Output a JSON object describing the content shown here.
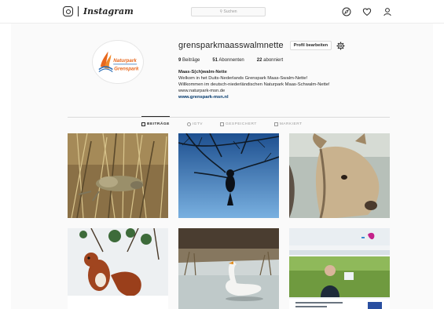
{
  "app": {
    "logo_text": "Instagram"
  },
  "search": {
    "placeholder": "Suchen"
  },
  "nav": {
    "icons": [
      "compass-icon",
      "heart-icon",
      "person-icon"
    ]
  },
  "profile": {
    "username": "grensparkmaasswalmnette",
    "edit_label": "Profil bearbeiten",
    "stats": [
      {
        "count": "9",
        "label": "Beiträge"
      },
      {
        "count": "51",
        "label": "Abonnenten"
      },
      {
        "count": "22",
        "label": "abonniert"
      }
    ],
    "bio": {
      "name": "Maas-S(ch)walm-Nette",
      "line1": "Welkom in het Duits-Nederlands Grenspark Maas-Swalm-Nette!",
      "line2": "Willkommen im deutsch-niederländischen Naturpark Maas-Schwalm-Nette!",
      "line3": "www.naturpark-msn.de",
      "link": "www.grenspark-msn.nl"
    },
    "avatar_text": {
      "top": "Naturpark",
      "bottom": "Grenspark"
    }
  },
  "tabs": [
    {
      "label": "BEITRÄGE",
      "active": true
    },
    {
      "label": "IGTV",
      "active": false
    },
    {
      "label": "GESPEICHERT",
      "active": false
    },
    {
      "label": "MARKIERT",
      "active": false
    }
  ],
  "posts": [
    "frog",
    "bird-on-branch",
    "horse",
    "red-squirrel",
    "swan",
    "poster"
  ],
  "colors": {
    "link": "#00376b",
    "border": "#dbdbdb",
    "text": "#262626",
    "muted": "#999999"
  }
}
